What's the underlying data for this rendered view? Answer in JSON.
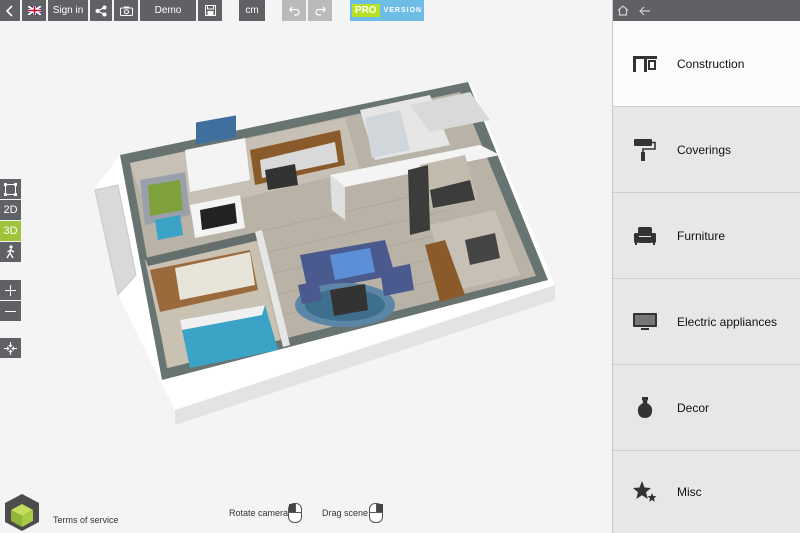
{
  "toolbar": {
    "sign_in_label": "Sign in",
    "demo_label": "Demo",
    "unit_label": "cm",
    "pro_label": "PRO",
    "version_label": "VERSION"
  },
  "left_tools": {
    "view_2d_label": "2D",
    "view_3d_label": "3D"
  },
  "footer": {
    "terms_label": "Terms of service",
    "rotate_hint": "Rotate camera",
    "drag_hint": "Drag scene"
  },
  "categories": [
    {
      "label": "Construction",
      "icon": "construction-icon"
    },
    {
      "label": "Coverings",
      "icon": "paint-roller-icon"
    },
    {
      "label": "Furniture",
      "icon": "armchair-icon"
    },
    {
      "label": "Electric appliances",
      "icon": "tv-icon"
    },
    {
      "label": "Decor",
      "icon": "vase-icon"
    },
    {
      "label": "Misc",
      "icon": "stars-icon"
    }
  ],
  "colors": {
    "toolbar_bg": "#5f6165",
    "accent_green": "#9ec43b",
    "pro_blue": "#6ebde6",
    "panel_bg": "#e7e7e7"
  }
}
